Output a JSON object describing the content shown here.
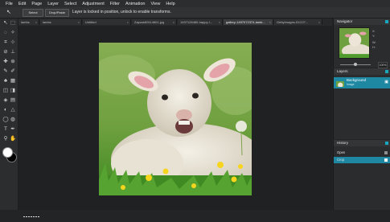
{
  "menu": [
    "File",
    "Edit",
    "Page",
    "Layer",
    "Select",
    "Adjustment",
    "Filter",
    "Animation",
    "View",
    "Help"
  ],
  "toolbar": {
    "arrow": "↖",
    "buttons": [
      "Select",
      "Drop/Paste"
    ],
    "info": "Layer is locked in position, unlock to enable transforms."
  },
  "tabs": [
    {
      "label": "lambs",
      "active": false
    },
    {
      "label": "lambs",
      "active": false
    },
    {
      "label": "Untitled",
      "active": false
    },
    {
      "label": "Zapusk89114601.jpg",
      "active": false
    },
    {
      "label": "1497128480-happy-l...",
      "active": false
    },
    {
      "label": "gallery-1497072374-lamb...",
      "active": true
    },
    {
      "label": "GettyImages-51C07...",
      "active": false
    }
  ],
  "tab_close": "×",
  "navigator": {
    "title": "Navigator",
    "labels": [
      "X:",
      "Y:",
      "W:",
      "H:"
    ],
    "zoom": "100%"
  },
  "layers": {
    "title": "Layers",
    "layer_name": "Background",
    "layer_sub": "image"
  },
  "history": {
    "title": "History",
    "items": [
      {
        "label": "Open",
        "active": false
      },
      {
        "label": "Crop",
        "active": true
      }
    ]
  },
  "colors": {
    "accent": "#1e88a3",
    "accent_bright": "#19a8c0",
    "bg": "#222426",
    "sky": "#7ea84d",
    "grass": "#4f9b2d"
  }
}
